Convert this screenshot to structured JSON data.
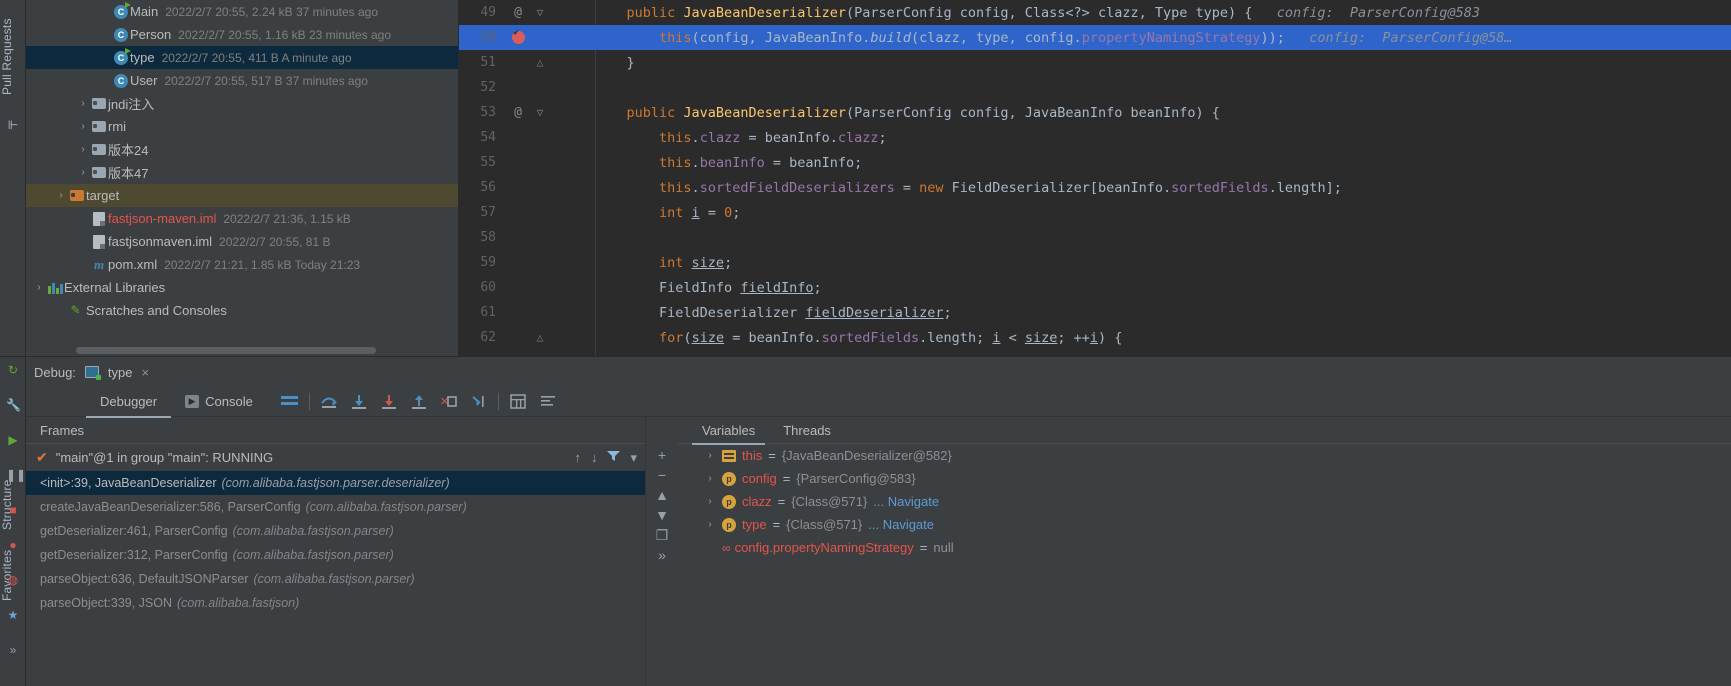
{
  "left_strip": {
    "items": [
      {
        "label": "Pull Requests",
        "icon": "pull-request-icon"
      },
      {
        "label": "",
        "icon": "commit-icon"
      }
    ]
  },
  "left_strip_bottom": {
    "items": [
      {
        "label": "Structure",
        "icon": "structure-icon"
      },
      {
        "label": "Favorites",
        "icon": "favorites-icon"
      }
    ]
  },
  "project_tree": {
    "rows": [
      {
        "indent": 3,
        "chevron": "",
        "icon": "class-runnable-icon",
        "name": "Main",
        "name_color": "plain",
        "meta": "2022/2/7 20:55, 2.24 kB 37 minutes ago",
        "selected": ""
      },
      {
        "indent": 3,
        "chevron": "",
        "icon": "class-icon",
        "name": "Person",
        "name_color": "plain",
        "meta": "2022/2/7 20:55, 1.16 kB 23 minutes ago",
        "selected": ""
      },
      {
        "indent": 3,
        "chevron": "",
        "icon": "class-runnable-icon",
        "name": "type",
        "name_color": "plain",
        "meta": "2022/2/7 20:55, 411 B A minute ago",
        "selected": "blue"
      },
      {
        "indent": 3,
        "chevron": "",
        "icon": "class-icon",
        "name": "User",
        "name_color": "plain",
        "meta": "2022/2/7 20:55, 517 B 37 minutes ago",
        "selected": ""
      },
      {
        "indent": 2,
        "chevron": "›",
        "icon": "folder-icon",
        "name": "jndi注入",
        "name_color": "plain",
        "meta": "",
        "selected": ""
      },
      {
        "indent": 2,
        "chevron": "›",
        "icon": "folder-icon",
        "name": "rmi",
        "name_color": "plain",
        "meta": "",
        "selected": ""
      },
      {
        "indent": 2,
        "chevron": "›",
        "icon": "folder-icon",
        "name": "版本24",
        "name_color": "plain",
        "meta": "",
        "selected": ""
      },
      {
        "indent": 2,
        "chevron": "›",
        "icon": "folder-icon",
        "name": "版本47",
        "name_color": "plain",
        "meta": "",
        "selected": ""
      },
      {
        "indent": 1,
        "chevron": "›",
        "icon": "folder-orange-icon",
        "name": "target",
        "name_color": "plain",
        "meta": "",
        "selected": "olive"
      },
      {
        "indent": 2,
        "chevron": "",
        "icon": "iml-file-icon",
        "name": "fastjson-maven.iml",
        "name_color": "red",
        "meta": "2022/2/7 21:36, 1.15 kB",
        "selected": ""
      },
      {
        "indent": 2,
        "chevron": "",
        "icon": "iml-file-icon",
        "name": "fastjsonmaven.iml",
        "name_color": "plain",
        "meta": "2022/2/7 20:55, 81 B",
        "selected": ""
      },
      {
        "indent": 2,
        "chevron": "",
        "icon": "maven-icon",
        "name": "pom.xml",
        "name_color": "plain",
        "meta": "2022/2/7 21:21, 1.85 kB Today 21:23",
        "selected": ""
      },
      {
        "indent": 0,
        "chevron": "›",
        "icon": "libraries-icon",
        "name": "External Libraries",
        "name_color": "plain",
        "meta": "",
        "selected": ""
      },
      {
        "indent": 1,
        "chevron": "",
        "icon": "scratches-icon",
        "name": "Scratches and Consoles",
        "name_color": "plain",
        "meta": "",
        "selected": ""
      }
    ]
  },
  "editor": {
    "lines": [
      {
        "num": "49",
        "mark": "@",
        "fold": "▽",
        "highlight": false,
        "tokens": [
          {
            "t": "    ",
            "c": "pl"
          },
          {
            "t": "public ",
            "c": "k"
          },
          {
            "t": "JavaBeanDeserializer",
            "c": "t"
          },
          {
            "t": "(ParserConfig config, Class<?> clazz, Type type) {",
            "c": "pl"
          }
        ],
        "hint": "   config:  ParserConfig@583"
      },
      {
        "num": "50",
        "mark": "breakpoint",
        "fold": "",
        "highlight": true,
        "tokens": [
          {
            "t": "        ",
            "c": "pl"
          },
          {
            "t": "this",
            "c": "k"
          },
          {
            "t": "(config, JavaBeanInfo.",
            "c": "pl"
          },
          {
            "t": "build",
            "c": "mi"
          },
          {
            "t": "(clazz, type, config.",
            "c": "pl"
          },
          {
            "t": "propertyNamingStrategy",
            "c": "f"
          },
          {
            "t": "));",
            "c": "pl"
          }
        ],
        "hint": "   config:  ParserConfig@58…"
      },
      {
        "num": "51",
        "mark": "",
        "fold": "△",
        "highlight": false,
        "tokens": [
          {
            "t": "    }",
            "c": "pl"
          }
        ],
        "hint": ""
      },
      {
        "num": "52",
        "mark": "",
        "fold": "",
        "highlight": false,
        "tokens": [],
        "hint": ""
      },
      {
        "num": "53",
        "mark": "@",
        "fold": "▽",
        "highlight": false,
        "tokens": [
          {
            "t": "    ",
            "c": "pl"
          },
          {
            "t": "public ",
            "c": "k"
          },
          {
            "t": "JavaBeanDeserializer",
            "c": "t"
          },
          {
            "t": "(ParserConfig config, JavaBeanInfo beanInfo) {",
            "c": "pl"
          }
        ],
        "hint": ""
      },
      {
        "num": "54",
        "mark": "",
        "fold": "",
        "highlight": false,
        "tokens": [
          {
            "t": "        ",
            "c": "pl"
          },
          {
            "t": "this",
            "c": "k"
          },
          {
            "t": ".",
            "c": "pl"
          },
          {
            "t": "clazz",
            "c": "f"
          },
          {
            "t": " = beanInfo.",
            "c": "pl"
          },
          {
            "t": "clazz",
            "c": "f"
          },
          {
            "t": ";",
            "c": "pl"
          }
        ],
        "hint": ""
      },
      {
        "num": "55",
        "mark": "",
        "fold": "",
        "highlight": false,
        "tokens": [
          {
            "t": "        ",
            "c": "pl"
          },
          {
            "t": "this",
            "c": "k"
          },
          {
            "t": ".",
            "c": "pl"
          },
          {
            "t": "beanInfo",
            "c": "f"
          },
          {
            "t": " = beanInfo;",
            "c": "pl"
          }
        ],
        "hint": ""
      },
      {
        "num": "56",
        "mark": "",
        "fold": "",
        "highlight": false,
        "tokens": [
          {
            "t": "        ",
            "c": "pl"
          },
          {
            "t": "this",
            "c": "k"
          },
          {
            "t": ".",
            "c": "pl"
          },
          {
            "t": "sortedFieldDeserializers",
            "c": "f"
          },
          {
            "t": " = ",
            "c": "pl"
          },
          {
            "t": "new ",
            "c": "k"
          },
          {
            "t": "FieldDeserializer[beanInfo.",
            "c": "pl"
          },
          {
            "t": "sortedFields",
            "c": "f"
          },
          {
            "t": ".length];",
            "c": "pl"
          }
        ],
        "hint": ""
      },
      {
        "num": "57",
        "mark": "",
        "fold": "",
        "highlight": false,
        "tokens": [
          {
            "t": "        ",
            "c": "pl"
          },
          {
            "t": "int ",
            "c": "k"
          },
          {
            "t": "i",
            "c": "um"
          },
          {
            "t": " = ",
            "c": "pl"
          },
          {
            "t": "0",
            "c": "k"
          },
          {
            "t": ";",
            "c": "pl"
          }
        ],
        "hint": ""
      },
      {
        "num": "58",
        "mark": "",
        "fold": "",
        "highlight": false,
        "tokens": [],
        "hint": ""
      },
      {
        "num": "59",
        "mark": "",
        "fold": "",
        "highlight": false,
        "tokens": [
          {
            "t": "        ",
            "c": "pl"
          },
          {
            "t": "int ",
            "c": "k"
          },
          {
            "t": "size",
            "c": "um"
          },
          {
            "t": ";",
            "c": "pl"
          }
        ],
        "hint": ""
      },
      {
        "num": "60",
        "mark": "",
        "fold": "",
        "highlight": false,
        "tokens": [
          {
            "t": "        FieldInfo ",
            "c": "pl"
          },
          {
            "t": "fieldInfo",
            "c": "um"
          },
          {
            "t": ";",
            "c": "pl"
          }
        ],
        "hint": ""
      },
      {
        "num": "61",
        "mark": "",
        "fold": "",
        "highlight": false,
        "tokens": [
          {
            "t": "        FieldDeserializer ",
            "c": "pl"
          },
          {
            "t": "fieldDeserializer",
            "c": "um"
          },
          {
            "t": ";",
            "c": "pl"
          }
        ],
        "hint": ""
      },
      {
        "num": "62",
        "mark": "",
        "fold": "△",
        "highlight": false,
        "tokens": [
          {
            "t": "        ",
            "c": "pl"
          },
          {
            "t": "for",
            "c": "k"
          },
          {
            "t": "(",
            "c": "pl"
          },
          {
            "t": "size",
            "c": "um"
          },
          {
            "t": " = beanInfo.",
            "c": "pl"
          },
          {
            "t": "sortedFields",
            "c": "f"
          },
          {
            "t": ".length; ",
            "c": "pl"
          },
          {
            "t": "i",
            "c": "um"
          },
          {
            "t": " < ",
            "c": "pl"
          },
          {
            "t": "size",
            "c": "um"
          },
          {
            "t": "; ++",
            "c": "pl"
          },
          {
            "t": "i",
            "c": "um"
          },
          {
            "t": ") {",
            "c": "pl"
          }
        ],
        "hint": ""
      }
    ]
  },
  "debug_header": {
    "label": "Debug:",
    "config_name": "type",
    "close": "×"
  },
  "debug_tabs": {
    "tabs": [
      {
        "label": "Debugger",
        "icon": "",
        "active": true
      },
      {
        "label": "Console",
        "icon": "console-icon",
        "active": false
      }
    ],
    "toolbar": [
      {
        "name": "layout-settings-icon"
      },
      {
        "name": "step-over-icon"
      },
      {
        "name": "step-into-icon"
      },
      {
        "name": "force-step-into-icon"
      },
      {
        "name": "step-out-icon"
      },
      {
        "name": "drop-frame-icon"
      },
      {
        "name": "run-to-cursor-icon"
      },
      {
        "name": "evaluate-expression-icon"
      },
      {
        "name": "mute-breakpoints-icon"
      }
    ]
  },
  "frames_panel": {
    "title": "Frames",
    "thread": "\"main\"@1 in group \"main\": RUNNING",
    "thread_tools": [
      {
        "name": "frame-up-icon",
        "glyph": "↑"
      },
      {
        "name": "frame-down-icon",
        "glyph": "↓"
      },
      {
        "name": "filter-icon",
        "glyph": "filter"
      },
      {
        "name": "frames-dropdown-icon",
        "glyph": "▾"
      }
    ],
    "rows": [
      {
        "method": "<init>:39, JavaBeanDeserializer",
        "pkg": "(com.alibaba.fastjson.parser.deserializer)",
        "selected": true
      },
      {
        "method": "createJavaBeanDeserializer:586, ParserConfig",
        "pkg": "(com.alibaba.fastjson.parser)",
        "selected": false
      },
      {
        "method": "getDeserializer:461, ParserConfig",
        "pkg": "(com.alibaba.fastjson.parser)",
        "selected": false
      },
      {
        "method": "getDeserializer:312, ParserConfig",
        "pkg": "(com.alibaba.fastjson.parser)",
        "selected": false
      },
      {
        "method": "parseObject:636, DefaultJSONParser",
        "pkg": "(com.alibaba.fastjson.parser)",
        "selected": false
      },
      {
        "method": "parseObject:339, JSON",
        "pkg": "(com.alibaba.fastjson)",
        "selected": false
      }
    ]
  },
  "rail": {
    "buttons": [
      {
        "name": "add-watch-button",
        "glyph": "+"
      },
      {
        "name": "remove-watch-button",
        "glyph": "−"
      },
      {
        "name": "move-up-button",
        "glyph": "▲"
      },
      {
        "name": "move-down-button",
        "glyph": "▼"
      },
      {
        "name": "copy-button",
        "glyph": "❐"
      },
      {
        "name": "more-button",
        "glyph": "»"
      }
    ]
  },
  "variables_panel": {
    "tabs": [
      {
        "label": "Variables",
        "active": true
      },
      {
        "label": "Threads",
        "active": false
      }
    ],
    "rows": [
      {
        "arrow": "›",
        "icon": "object-icon",
        "name": "this",
        "eq": " = ",
        "value": "{JavaBeanDeserializer@582}",
        "nav": ""
      },
      {
        "arrow": "›",
        "icon": "param-icon",
        "name": "config",
        "eq": " = ",
        "value": "{ParserConfig@583}",
        "nav": ""
      },
      {
        "arrow": "›",
        "icon": "param-icon",
        "name": "clazz",
        "eq": " = ",
        "value": "{Class@571}",
        "nav": "... Navigate"
      },
      {
        "arrow": "›",
        "icon": "param-icon",
        "name": "type",
        "eq": " = ",
        "value": "{Class@571}",
        "nav": "... Navigate"
      },
      {
        "arrow": "",
        "icon": "chain-icon",
        "name": "config.propertyNamingStrategy",
        "eq": " = ",
        "value": "null",
        "nav": ""
      }
    ]
  },
  "debug_strip": {
    "items": [
      {
        "name": "rerun-icon",
        "glyph": "↻",
        "color": "#5fa832"
      },
      {
        "name": "settings-wrench-icon",
        "glyph": "🔧",
        "color": "#9aa0a6"
      },
      {
        "name": "resume-icon",
        "glyph": "▶",
        "color": "#5fa832"
      },
      {
        "name": "pause-icon",
        "glyph": "❚❚",
        "color": "#9aa0a6"
      },
      {
        "name": "stop-icon",
        "glyph": "■",
        "color": "#d1564f"
      },
      {
        "name": "view-breakpoints-icon",
        "glyph": "●",
        "color": "#d1564f"
      },
      {
        "name": "mute-breakpoints-icon",
        "glyph": "◍",
        "color": "#d1564f"
      },
      {
        "name": "pin-icon",
        "glyph": "★",
        "color": "#6fa3d1"
      },
      {
        "name": "more-icon",
        "glyph": "»",
        "color": "#9aa0a6"
      }
    ]
  }
}
